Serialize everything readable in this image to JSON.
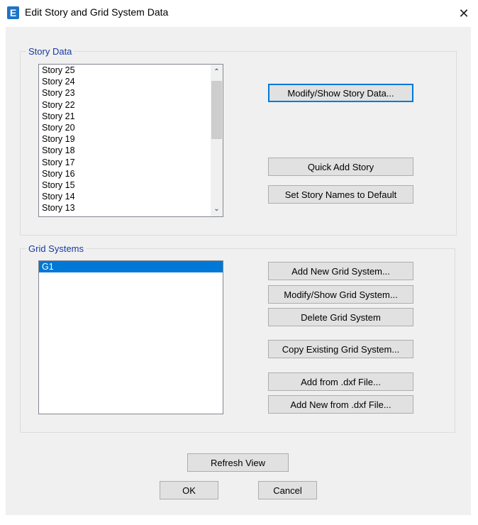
{
  "window": {
    "icon_letter": "E",
    "title": "Edit Story and Grid System Data",
    "close_glyph": "✕"
  },
  "story_data": {
    "group_label": "Story Data",
    "stories": [
      "Story 25",
      "Story 24",
      "Story 23",
      "Story 22",
      "Story 21",
      "Story 20",
      "Story 19",
      "Story 18",
      "Story 17",
      "Story 16",
      "Story 15",
      "Story 14",
      "Story 13"
    ],
    "buttons": {
      "modify_show": "Modify/Show Story Data...",
      "quick_add": "Quick Add Story",
      "set_default_names": "Set Story Names to Default"
    }
  },
  "grid_systems": {
    "group_label": "Grid Systems",
    "items": [
      "G1"
    ],
    "selected_index": 0,
    "buttons": {
      "add_new": "Add New Grid System...",
      "modify_show": "Modify/Show Grid System...",
      "delete": "Delete Grid System",
      "copy_existing": "Copy Existing Grid System...",
      "add_from_dxf": "Add  from .dxf File...",
      "add_new_from_dxf": "Add New from .dxf File..."
    }
  },
  "footer": {
    "refresh_view": "Refresh View",
    "ok": "OK",
    "cancel": "Cancel"
  },
  "icons": {
    "scroll_up": "⌃",
    "scroll_down": "⌄"
  },
  "colors": {
    "accent": "#0078d7",
    "group_label": "#1a3aa0",
    "app_icon": "#1e73c8"
  }
}
